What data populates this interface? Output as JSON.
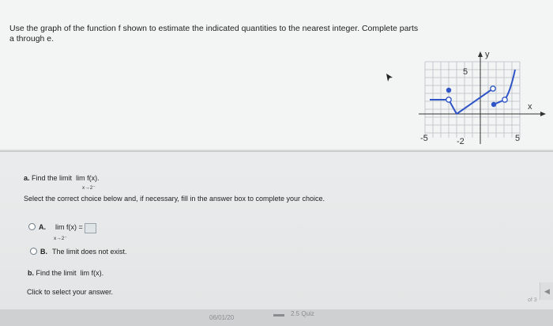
{
  "question": {
    "text": "Use the graph of the function f shown to estimate the indicated quantities to the nearest integer. Complete parts a through e."
  },
  "graph": {
    "y_label": "y",
    "x_label": "x",
    "tick_y": "5",
    "tick_x_neg5": "-5",
    "tick_x_neg2": "-2",
    "tick_x_5": "5"
  },
  "part_a": {
    "label": "a.",
    "prompt": "Find the limit",
    "lim": "lim",
    "fx": "f(x).",
    "sub": "x→2⁻"
  },
  "instruction": "Select the correct choice below and, if necessary, fill in the answer box to complete your choice.",
  "choice_a": {
    "letter": "A.",
    "lim": "lim",
    "expr": "f(x) =",
    "sub": "x→2⁻"
  },
  "choice_b": {
    "letter": "B.",
    "text": "The limit does not exist."
  },
  "part_b": {
    "label": "b.",
    "prompt": "Find the limit",
    "lim": "lim",
    "fx": "f(x)."
  },
  "click_select": "Click to select your answer.",
  "footer": {
    "date": "06/01/20",
    "quiz": "2.5 Quiz",
    "corner": "of 3"
  }
}
